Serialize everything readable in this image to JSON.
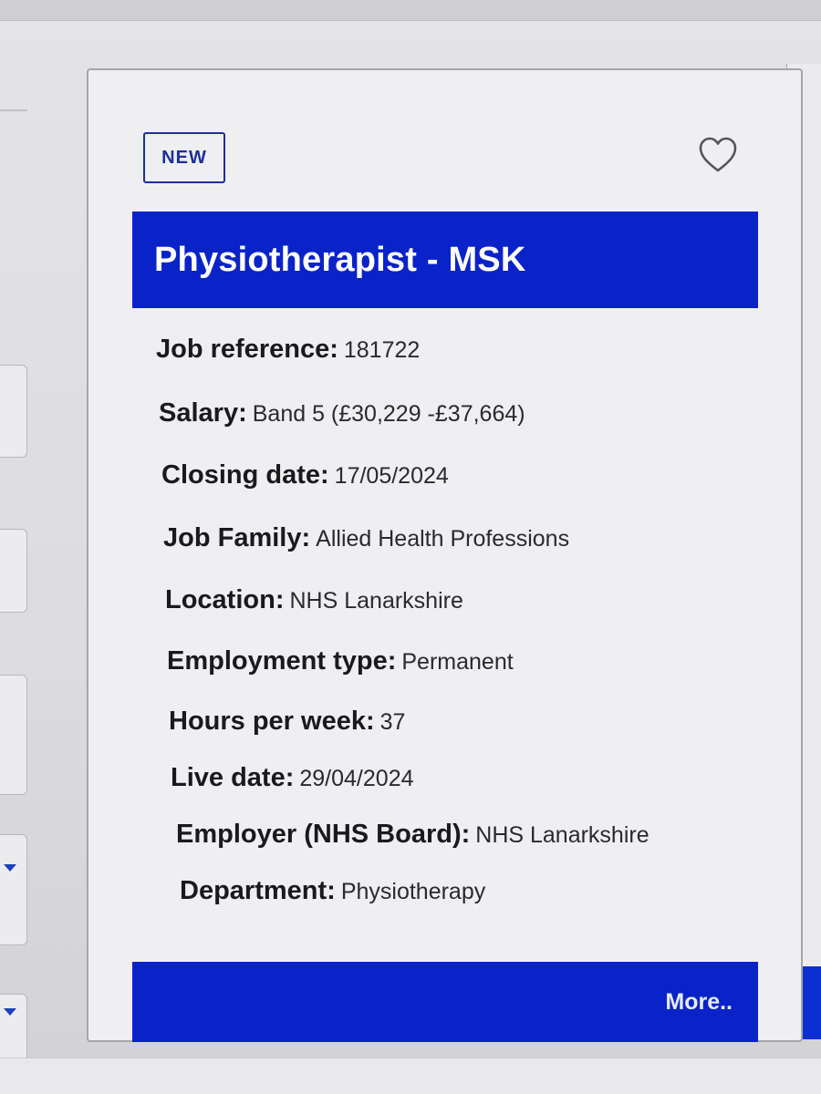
{
  "card": {
    "badge": "NEW",
    "favourite_icon": "heart-outline-icon",
    "title": "Physiotherapist - MSK",
    "details": [
      {
        "label": "Job reference:",
        "value": "181722"
      },
      {
        "label": "Salary:",
        "value": "Band 5 (£30,229 -£37,664)"
      },
      {
        "label": "Closing date:",
        "value": "17/05/2024"
      },
      {
        "label": "Job Family:",
        "value": "Allied Health Professions"
      },
      {
        "label": "Location:",
        "value": "NHS Lanarkshire"
      },
      {
        "label": "Employment type:",
        "value": "Permanent"
      },
      {
        "label": "Hours per week:",
        "value": "37"
      },
      {
        "label": "Live date:",
        "value": "29/04/2024"
      },
      {
        "label": "Employer (NHS Board):",
        "value": "NHS Lanarkshire"
      },
      {
        "label": "Department:",
        "value": "Physiotherapy"
      }
    ],
    "more_label": "More.."
  },
  "colors": {
    "accent": "#0a23c8",
    "badge_border": "#1c2f9c",
    "card_background": "#efeff1"
  },
  "left_filters": {
    "dropdown_icon": "caret-down-icon"
  }
}
